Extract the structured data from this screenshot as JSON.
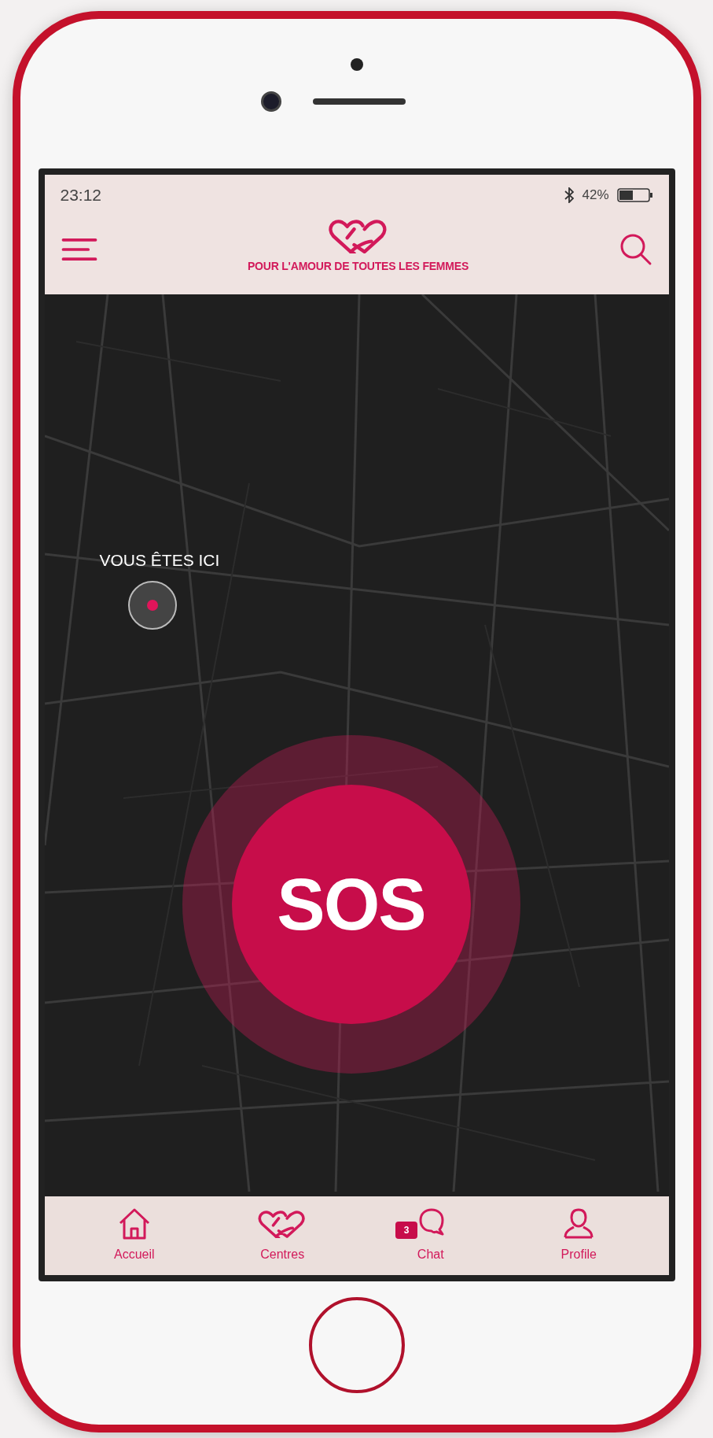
{
  "status_bar": {
    "time": "23:12",
    "battery": "42%"
  },
  "header": {
    "title": "POUR L'AMOUR DE TOUTES LES FEMMES"
  },
  "map": {
    "location_label": "VOUS ÊTES ICI"
  },
  "sos_button": {
    "label": "SOS"
  },
  "nav": [
    {
      "kind": "home",
      "label": "Accueil"
    },
    {
      "kind": "hearts",
      "label": "Centres"
    },
    {
      "kind": "chat",
      "label": "Chat",
      "badge": "3"
    },
    {
      "kind": "profile",
      "label": "Profile"
    }
  ]
}
